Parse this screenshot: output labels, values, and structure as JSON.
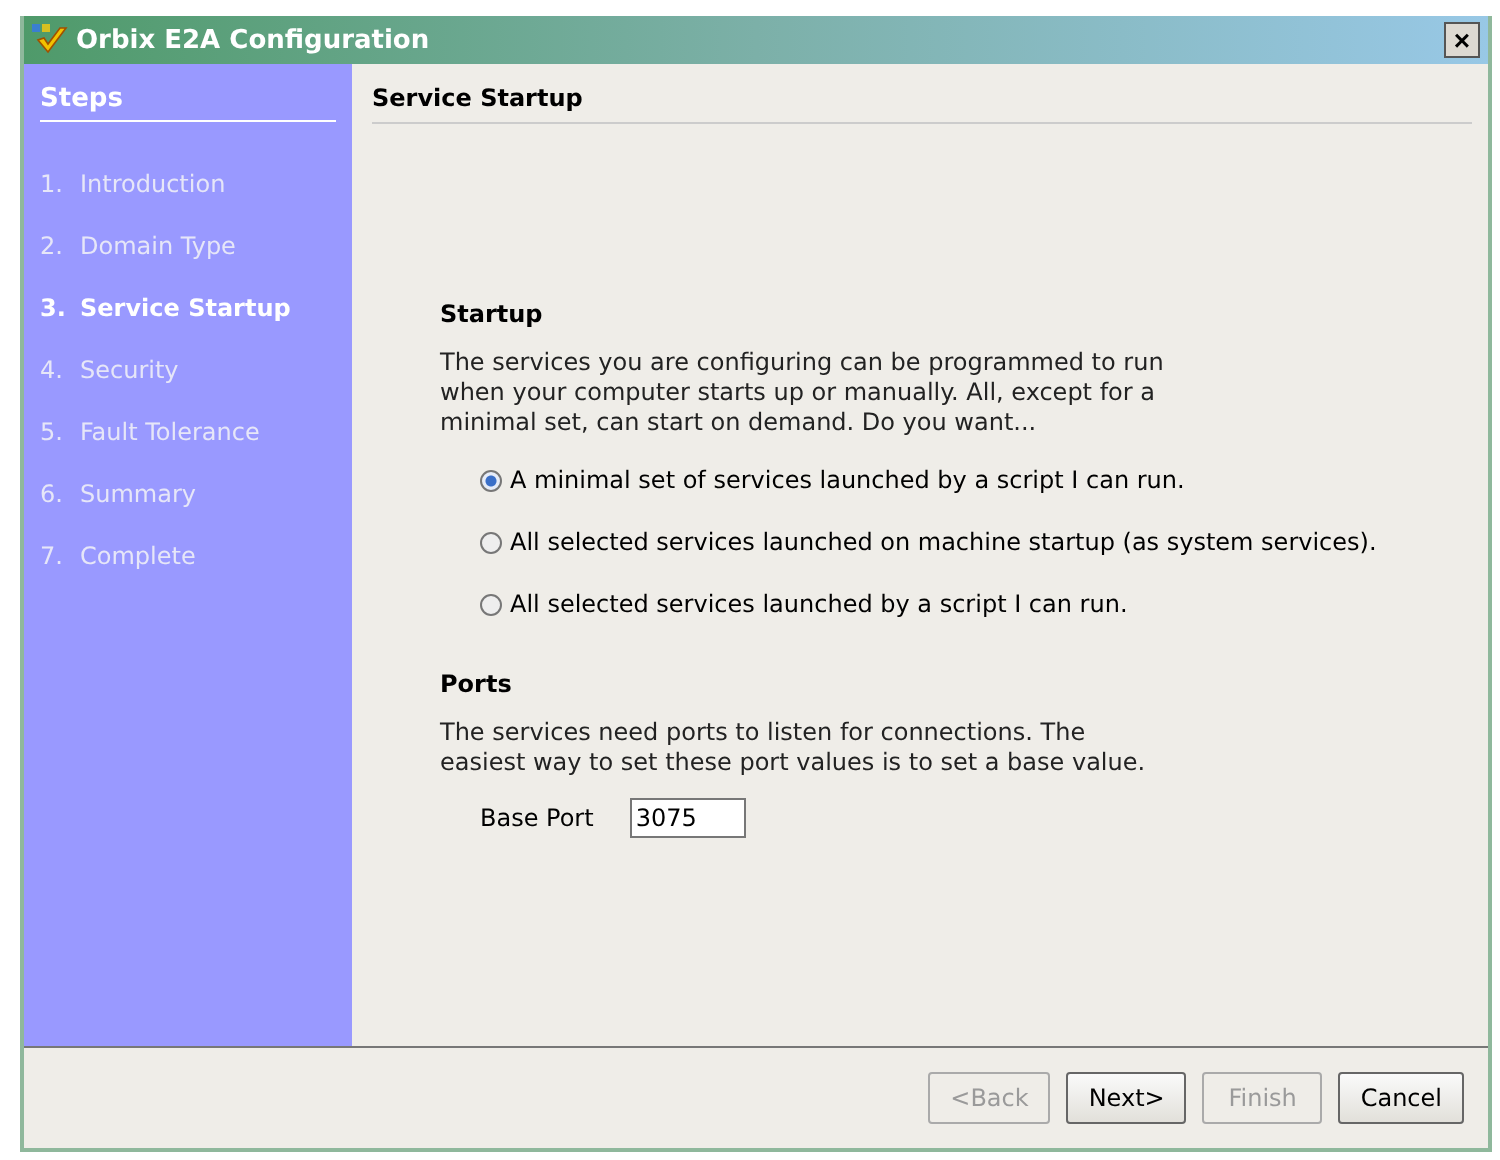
{
  "window": {
    "title": "Orbix E2A Configuration",
    "close": "×"
  },
  "sidebar": {
    "heading": "Steps",
    "items": [
      {
        "number": "1.",
        "label": "Introduction",
        "selected": false
      },
      {
        "number": "2.",
        "label": "Domain Type",
        "selected": false
      },
      {
        "number": "3.",
        "label": "Service Startup",
        "selected": true
      },
      {
        "number": "4.",
        "label": "Security",
        "selected": false
      },
      {
        "number": "5.",
        "label": "Fault Tolerance",
        "selected": false
      },
      {
        "number": "6.",
        "label": "Summary",
        "selected": false
      },
      {
        "number": "7.",
        "label": "Complete",
        "selected": false
      }
    ]
  },
  "page_title": "Service Startup",
  "startup": {
    "heading": "Startup",
    "text": "The services you are configuring can be programmed to run\nwhen your computer starts up or manually. All, except for a\nminimal set, can start on demand. Do you want...",
    "options": [
      {
        "label": "A minimal set of services launched by a script I can run.",
        "selected": true
      },
      {
        "label": "All selected services launched on machine startup (as system services).",
        "selected": false
      },
      {
        "label": "All selected services launched by a script I can run.",
        "selected": false
      }
    ]
  },
  "ports": {
    "heading": "Ports",
    "text": "The services need ports to listen for connections. The\neasiest way to set these port values is to set a base value.",
    "field_label": "Base Port",
    "value": "3075"
  },
  "buttons": [
    {
      "label": "<Back",
      "disabled": true
    },
    {
      "label": "Next>",
      "disabled": false
    },
    {
      "label": "Finish",
      "disabled": true
    },
    {
      "label": "Cancel",
      "disabled": false
    }
  ]
}
